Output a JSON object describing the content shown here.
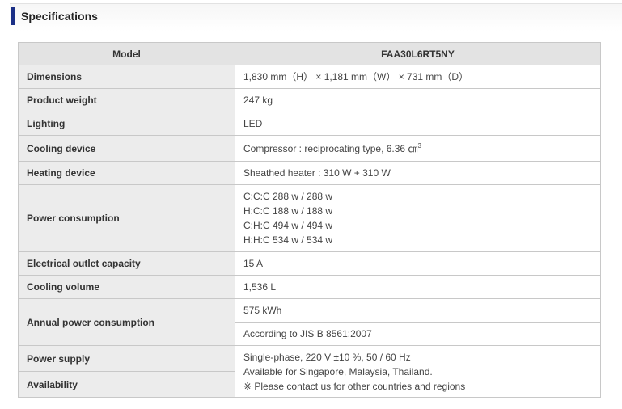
{
  "section": {
    "title": "Specifications"
  },
  "table": {
    "model_label": "Model",
    "model_value": "FAA30L6RT5NY",
    "rows": {
      "dimensions": {
        "label": "Dimensions",
        "value": "1,830 mm（H） × 1,181 mm（W） × 731 mm（D）"
      },
      "weight": {
        "label": "Product weight",
        "value": "247 kg"
      },
      "lighting": {
        "label": "Lighting",
        "value": "LED"
      },
      "cooling_device": {
        "label": "Cooling device",
        "value": "Compressor : reciprocating type, 6.36 ㎝",
        "value_sup": "3"
      },
      "heating_device": {
        "label": "Heating device",
        "value": "Sheathed heater : 310 W + 310 W"
      },
      "power_consumption": {
        "label": "Power consumption",
        "lines": [
          "C:C:C 288 w / 288 w",
          "H:C:C 188 w / 188 w",
          "C:H:C 494 w / 494 w",
          "H:H:C 534 w / 534 w"
        ]
      },
      "outlet": {
        "label": "Electrical outlet capacity",
        "value": "15 A"
      },
      "cooling_volume": {
        "label": "Cooling volume",
        "value": "1,536 L"
      },
      "annual_power": {
        "label": "Annual power consumption",
        "value": "575 kWh",
        "note": "According to JIS B 8561:2007"
      },
      "power_supply": {
        "label": "Power supply"
      },
      "availability": {
        "label": "Availability"
      },
      "supply_availability_lines": [
        "Single-phase, 220 V ±10 %, 50 / 60 Hz",
        "Available for Singapore, Malaysia, Thailand.",
        "※ Please contact us for other countries and regions"
      ]
    }
  }
}
